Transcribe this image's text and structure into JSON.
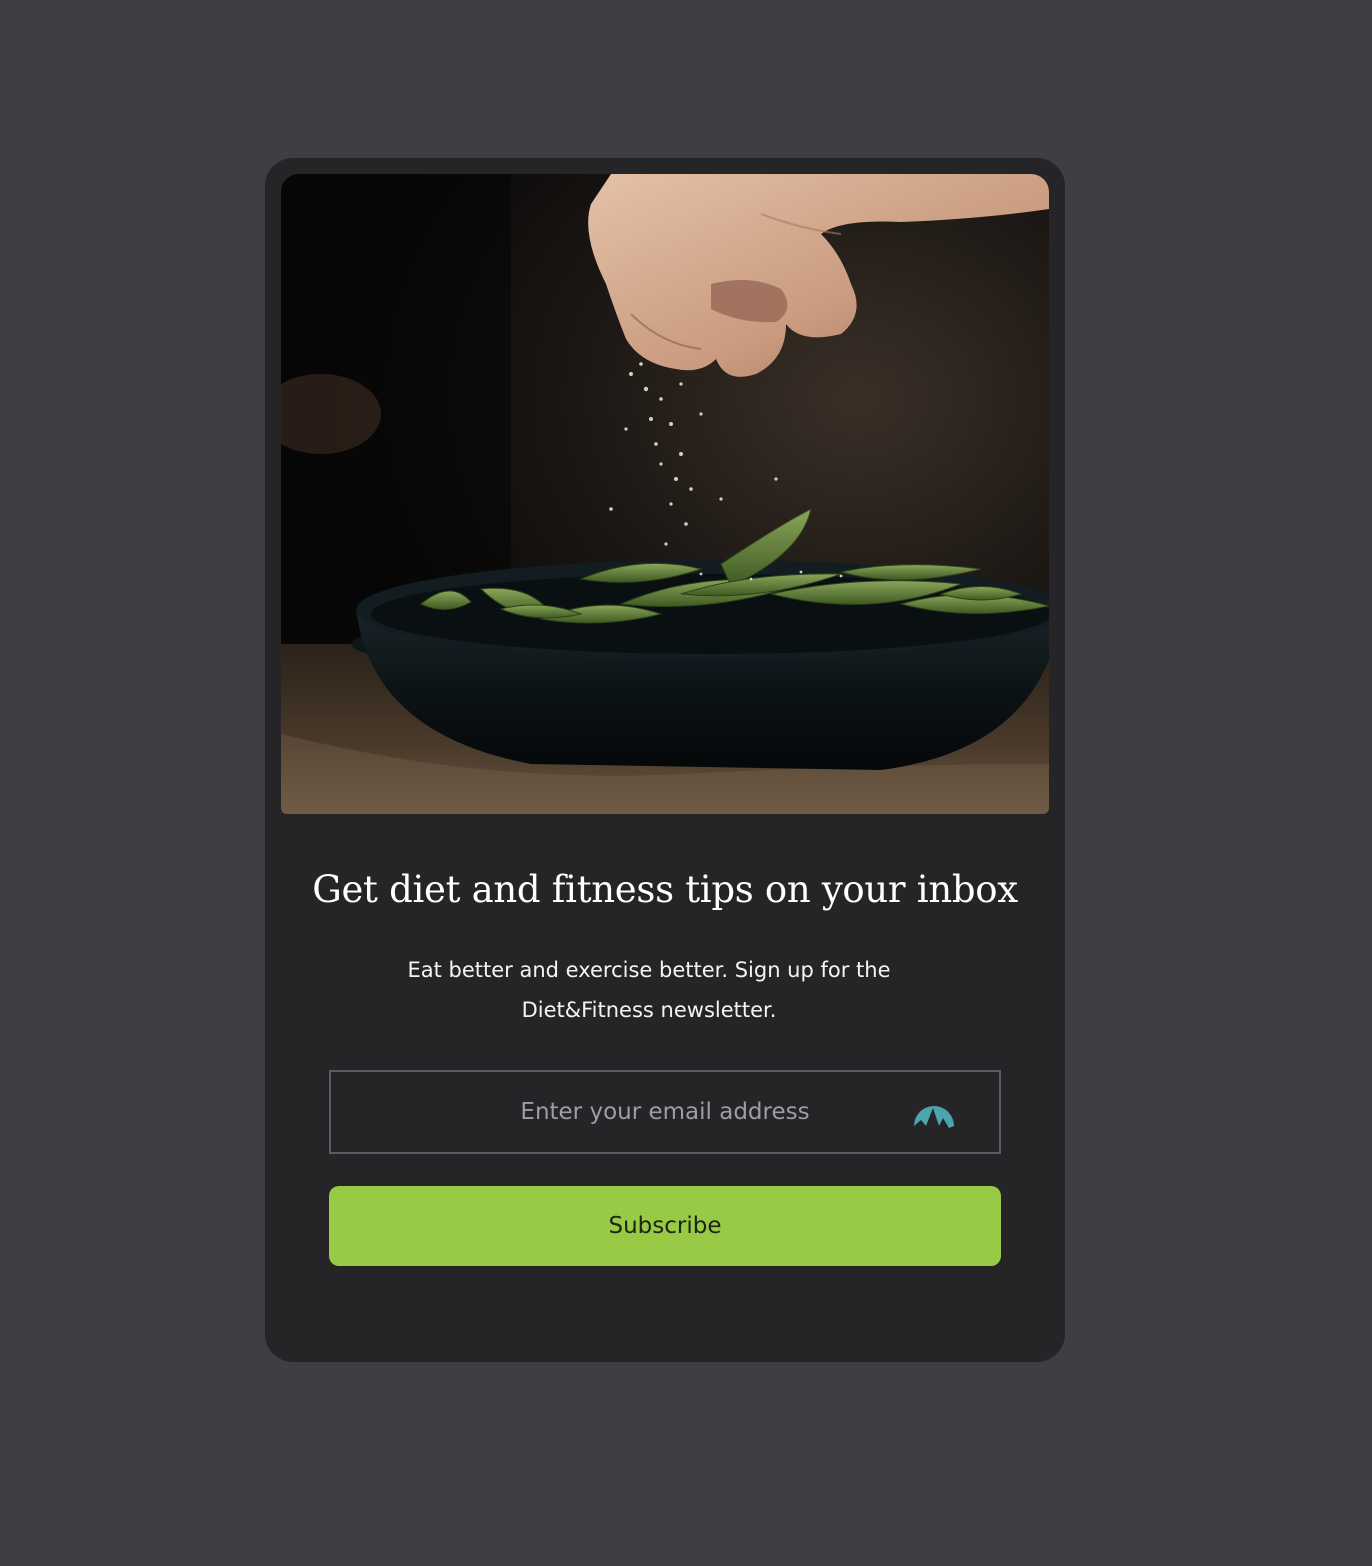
{
  "newsletter": {
    "title": "Get diet and fitness tips on your inbox",
    "description": "Eat better and exercise better. Sign up for the Diet&Fitness newsletter.",
    "email_placeholder": "Enter your email address",
    "subscribe_label": "Subscribe",
    "hero_image": "hand-sprinkling-salt-on-edamame-bowl",
    "extension_icon": "vpn-shield-icon"
  },
  "colors": {
    "page_background": "#3e3f44",
    "card_background": "#252528",
    "button_accent": "#98ca45",
    "extension_icon": "#4aa5ad"
  }
}
